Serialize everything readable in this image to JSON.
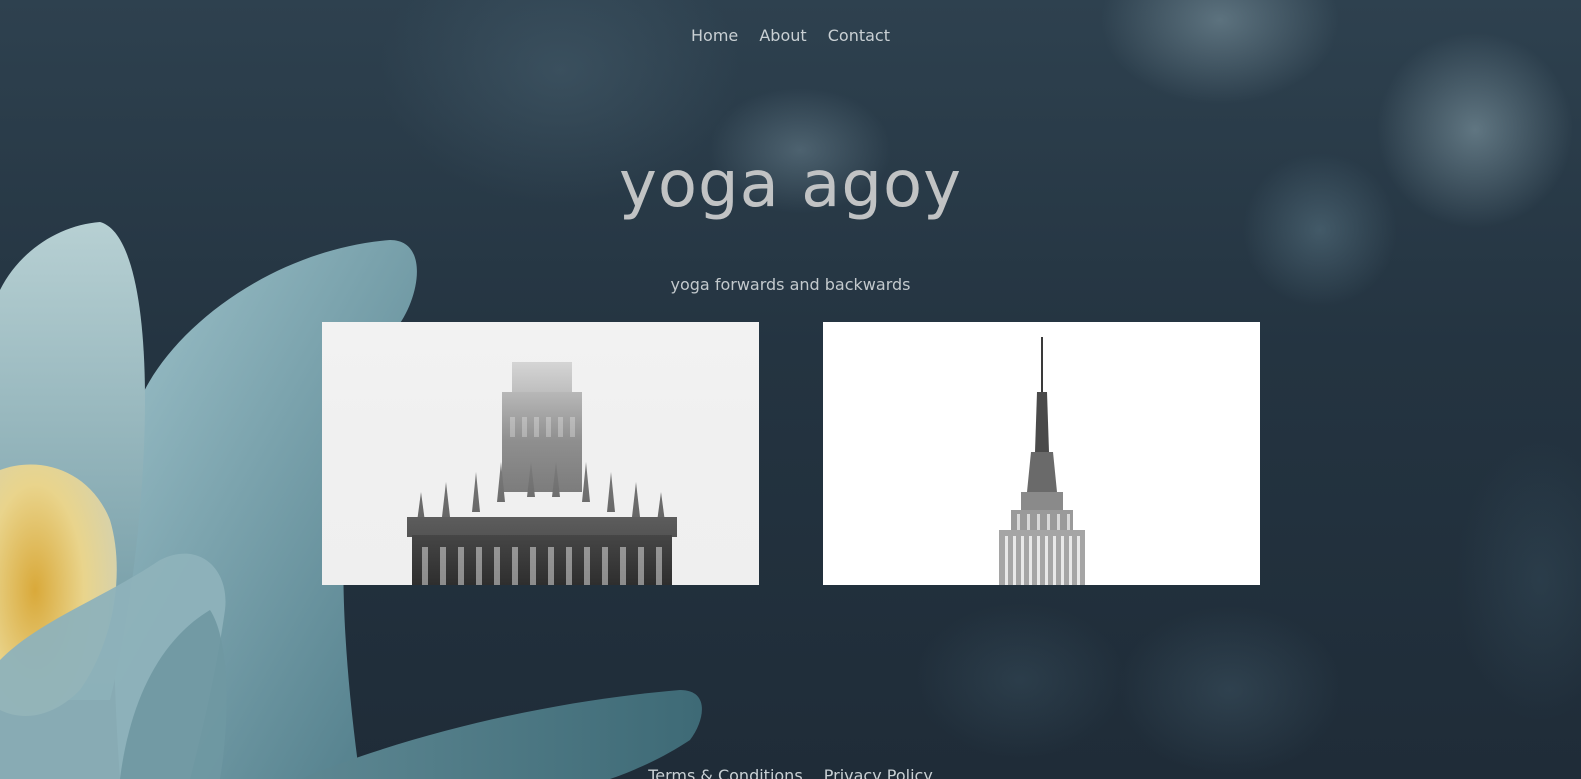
{
  "nav": {
    "items": [
      {
        "label": "Home"
      },
      {
        "label": "About"
      },
      {
        "label": "Contact"
      }
    ]
  },
  "hero": {
    "title": "yoga agoy",
    "subtitle": "yoga forwards and backwards"
  },
  "gallery": {
    "images": [
      {
        "depicts": "Palace of Culture tower top in fog"
      },
      {
        "depicts": "Empire State Building spire"
      }
    ]
  },
  "footer": {
    "links": [
      {
        "label": "Terms & Conditions"
      },
      {
        "label": "Privacy Policy"
      }
    ]
  },
  "colors": {
    "background": "#23303c",
    "text": "#c1c3c4",
    "petal": "#8fb3bd",
    "flower_center": "#e3c876"
  }
}
